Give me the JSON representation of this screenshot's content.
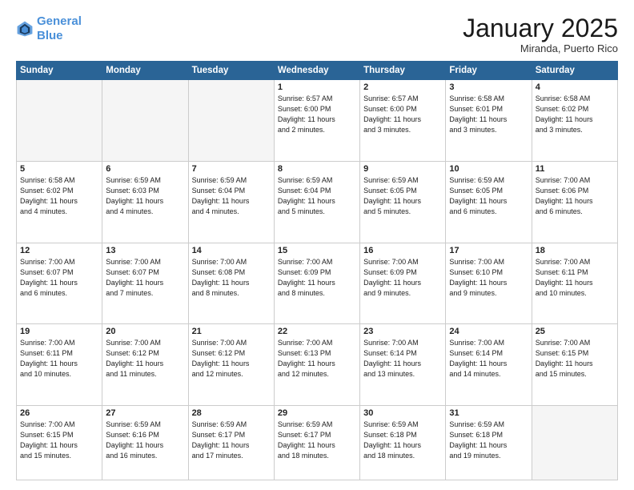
{
  "header": {
    "logo_line1": "General",
    "logo_line2": "Blue",
    "month": "January 2025",
    "location": "Miranda, Puerto Rico"
  },
  "days_of_week": [
    "Sunday",
    "Monday",
    "Tuesday",
    "Wednesday",
    "Thursday",
    "Friday",
    "Saturday"
  ],
  "weeks": [
    [
      {
        "day": "",
        "info": ""
      },
      {
        "day": "",
        "info": ""
      },
      {
        "day": "",
        "info": ""
      },
      {
        "day": "1",
        "info": "Sunrise: 6:57 AM\nSunset: 6:00 PM\nDaylight: 11 hours\nand 2 minutes."
      },
      {
        "day": "2",
        "info": "Sunrise: 6:57 AM\nSunset: 6:00 PM\nDaylight: 11 hours\nand 3 minutes."
      },
      {
        "day": "3",
        "info": "Sunrise: 6:58 AM\nSunset: 6:01 PM\nDaylight: 11 hours\nand 3 minutes."
      },
      {
        "day": "4",
        "info": "Sunrise: 6:58 AM\nSunset: 6:02 PM\nDaylight: 11 hours\nand 3 minutes."
      }
    ],
    [
      {
        "day": "5",
        "info": "Sunrise: 6:58 AM\nSunset: 6:02 PM\nDaylight: 11 hours\nand 4 minutes."
      },
      {
        "day": "6",
        "info": "Sunrise: 6:59 AM\nSunset: 6:03 PM\nDaylight: 11 hours\nand 4 minutes."
      },
      {
        "day": "7",
        "info": "Sunrise: 6:59 AM\nSunset: 6:04 PM\nDaylight: 11 hours\nand 4 minutes."
      },
      {
        "day": "8",
        "info": "Sunrise: 6:59 AM\nSunset: 6:04 PM\nDaylight: 11 hours\nand 5 minutes."
      },
      {
        "day": "9",
        "info": "Sunrise: 6:59 AM\nSunset: 6:05 PM\nDaylight: 11 hours\nand 5 minutes."
      },
      {
        "day": "10",
        "info": "Sunrise: 6:59 AM\nSunset: 6:05 PM\nDaylight: 11 hours\nand 6 minutes."
      },
      {
        "day": "11",
        "info": "Sunrise: 7:00 AM\nSunset: 6:06 PM\nDaylight: 11 hours\nand 6 minutes."
      }
    ],
    [
      {
        "day": "12",
        "info": "Sunrise: 7:00 AM\nSunset: 6:07 PM\nDaylight: 11 hours\nand 6 minutes."
      },
      {
        "day": "13",
        "info": "Sunrise: 7:00 AM\nSunset: 6:07 PM\nDaylight: 11 hours\nand 7 minutes."
      },
      {
        "day": "14",
        "info": "Sunrise: 7:00 AM\nSunset: 6:08 PM\nDaylight: 11 hours\nand 8 minutes."
      },
      {
        "day": "15",
        "info": "Sunrise: 7:00 AM\nSunset: 6:09 PM\nDaylight: 11 hours\nand 8 minutes."
      },
      {
        "day": "16",
        "info": "Sunrise: 7:00 AM\nSunset: 6:09 PM\nDaylight: 11 hours\nand 9 minutes."
      },
      {
        "day": "17",
        "info": "Sunrise: 7:00 AM\nSunset: 6:10 PM\nDaylight: 11 hours\nand 9 minutes."
      },
      {
        "day": "18",
        "info": "Sunrise: 7:00 AM\nSunset: 6:11 PM\nDaylight: 11 hours\nand 10 minutes."
      }
    ],
    [
      {
        "day": "19",
        "info": "Sunrise: 7:00 AM\nSunset: 6:11 PM\nDaylight: 11 hours\nand 10 minutes."
      },
      {
        "day": "20",
        "info": "Sunrise: 7:00 AM\nSunset: 6:12 PM\nDaylight: 11 hours\nand 11 minutes."
      },
      {
        "day": "21",
        "info": "Sunrise: 7:00 AM\nSunset: 6:12 PM\nDaylight: 11 hours\nand 12 minutes."
      },
      {
        "day": "22",
        "info": "Sunrise: 7:00 AM\nSunset: 6:13 PM\nDaylight: 11 hours\nand 12 minutes."
      },
      {
        "day": "23",
        "info": "Sunrise: 7:00 AM\nSunset: 6:14 PM\nDaylight: 11 hours\nand 13 minutes."
      },
      {
        "day": "24",
        "info": "Sunrise: 7:00 AM\nSunset: 6:14 PM\nDaylight: 11 hours\nand 14 minutes."
      },
      {
        "day": "25",
        "info": "Sunrise: 7:00 AM\nSunset: 6:15 PM\nDaylight: 11 hours\nand 15 minutes."
      }
    ],
    [
      {
        "day": "26",
        "info": "Sunrise: 7:00 AM\nSunset: 6:15 PM\nDaylight: 11 hours\nand 15 minutes."
      },
      {
        "day": "27",
        "info": "Sunrise: 6:59 AM\nSunset: 6:16 PM\nDaylight: 11 hours\nand 16 minutes."
      },
      {
        "day": "28",
        "info": "Sunrise: 6:59 AM\nSunset: 6:17 PM\nDaylight: 11 hours\nand 17 minutes."
      },
      {
        "day": "29",
        "info": "Sunrise: 6:59 AM\nSunset: 6:17 PM\nDaylight: 11 hours\nand 18 minutes."
      },
      {
        "day": "30",
        "info": "Sunrise: 6:59 AM\nSunset: 6:18 PM\nDaylight: 11 hours\nand 18 minutes."
      },
      {
        "day": "31",
        "info": "Sunrise: 6:59 AM\nSunset: 6:18 PM\nDaylight: 11 hours\nand 19 minutes."
      },
      {
        "day": "",
        "info": ""
      }
    ]
  ]
}
